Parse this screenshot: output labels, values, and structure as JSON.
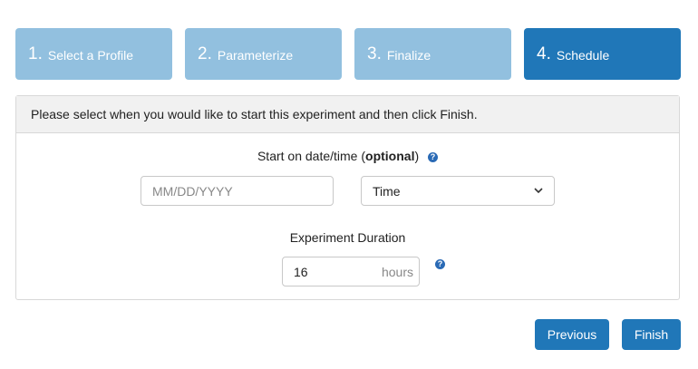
{
  "steps": [
    {
      "number": "1.",
      "label": "Select a Profile"
    },
    {
      "number": "2.",
      "label": "Parameterize"
    },
    {
      "number": "3.",
      "label": "Finalize"
    },
    {
      "number": "4.",
      "label": "Schedule"
    }
  ],
  "panel": {
    "heading": "Please select when you would like to start this experiment and then click Finish.",
    "start": {
      "label_prefix": "Start on date/time (",
      "label_bold": "optional",
      "label_suffix": ")",
      "help_icon": "?",
      "date_placeholder": "MM/DD/YYYY",
      "time_value": "Time",
      "time_chevron": "⌄"
    },
    "duration": {
      "label": "Experiment Duration",
      "value": "16",
      "unit": "hours",
      "help_icon": "?"
    }
  },
  "buttons": {
    "previous": "Previous",
    "finish": "Finish"
  },
  "colors": {
    "step_inactive": "#92c0df",
    "step_active": "#2077b8",
    "button": "#2077b8",
    "help_icon": "#2a6ab5"
  }
}
